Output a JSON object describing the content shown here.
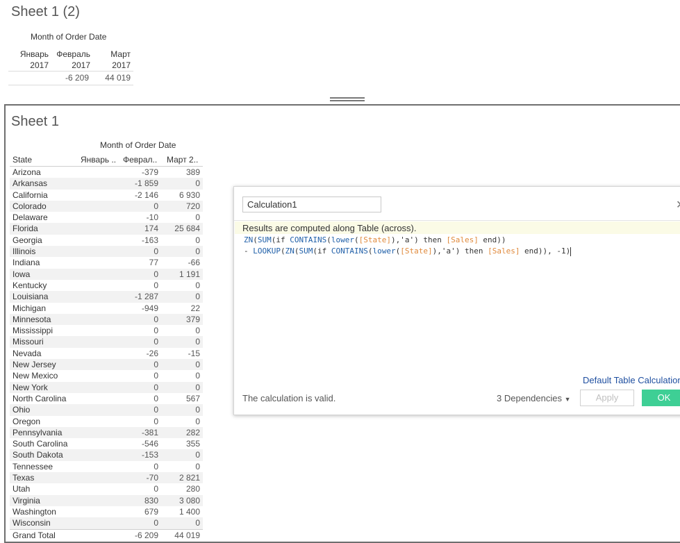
{
  "sheet2": {
    "title": "Sheet 1 (2)",
    "header_month": "Month of Order Date",
    "columns": [
      {
        "month": "Январь",
        "year": "2017"
      },
      {
        "month": "Февраль",
        "year": "2017"
      },
      {
        "month": "Март",
        "year": "2017"
      }
    ],
    "values": [
      "",
      "-6 209",
      "44 019"
    ]
  },
  "sheet1": {
    "title": "Sheet 1",
    "header_month": "Month of Order Date",
    "state_header": "State",
    "col_headers": [
      "Январь ..",
      "Феврал..",
      "Март 2.."
    ],
    "rows": [
      {
        "state": "Arizona",
        "feb": "-379",
        "mar": "389"
      },
      {
        "state": "Arkansas",
        "feb": "-1 859",
        "mar": "0"
      },
      {
        "state": "California",
        "feb": "-2 146",
        "mar": "6 930"
      },
      {
        "state": "Colorado",
        "feb": "0",
        "mar": "720"
      },
      {
        "state": "Delaware",
        "feb": "-10",
        "mar": "0"
      },
      {
        "state": "Florida",
        "feb": "174",
        "mar": "25 684"
      },
      {
        "state": "Georgia",
        "feb": "-163",
        "mar": "0"
      },
      {
        "state": "Illinois",
        "feb": "0",
        "mar": "0"
      },
      {
        "state": "Indiana",
        "feb": "77",
        "mar": "-66"
      },
      {
        "state": "Iowa",
        "feb": "0",
        "mar": "1 191"
      },
      {
        "state": "Kentucky",
        "feb": "0",
        "mar": "0"
      },
      {
        "state": "Louisiana",
        "feb": "-1 287",
        "mar": "0"
      },
      {
        "state": "Michigan",
        "feb": "-949",
        "mar": "22"
      },
      {
        "state": "Minnesota",
        "feb": "0",
        "mar": "379"
      },
      {
        "state": "Mississippi",
        "feb": "0",
        "mar": "0"
      },
      {
        "state": "Missouri",
        "feb": "0",
        "mar": "0"
      },
      {
        "state": "Nevada",
        "feb": "-26",
        "mar": "-15"
      },
      {
        "state": "New Jersey",
        "feb": "0",
        "mar": "0"
      },
      {
        "state": "New Mexico",
        "feb": "0",
        "mar": "0"
      },
      {
        "state": "New York",
        "feb": "0",
        "mar": "0"
      },
      {
        "state": "North Carolina",
        "feb": "0",
        "mar": "567"
      },
      {
        "state": "Ohio",
        "feb": "0",
        "mar": "0"
      },
      {
        "state": "Oregon",
        "feb": "0",
        "mar": "0"
      },
      {
        "state": "Pennsylvania",
        "feb": "-381",
        "mar": "282"
      },
      {
        "state": "South Carolina",
        "feb": "-546",
        "mar": "355"
      },
      {
        "state": "South Dakota",
        "feb": "-153",
        "mar": "0"
      },
      {
        "state": "Tennessee",
        "feb": "0",
        "mar": "0"
      },
      {
        "state": "Texas",
        "feb": "-70",
        "mar": "2 821"
      },
      {
        "state": "Utah",
        "feb": "0",
        "mar": "280"
      },
      {
        "state": "Virginia",
        "feb": "830",
        "mar": "3 080"
      },
      {
        "state": "Washington",
        "feb": "679",
        "mar": "1 400"
      },
      {
        "state": "Wisconsin",
        "feb": "0",
        "mar": "0"
      }
    ],
    "grand_total": {
      "state": "Grand Total",
      "feb": "-6 209",
      "mar": "44 019"
    }
  },
  "dialog": {
    "calc_name": "Calculation1",
    "close_icon": "close-icon",
    "results_text": "Results are computed along Table (across).",
    "code_line1": "ZN(SUM(if CONTAINS(lower([State]),'a') then [Sales] end))",
    "code_line2": "- LOOKUP(ZN(SUM(if CONTAINS(lower([State]),'a') then [Sales] end)), -1)",
    "default_link": "Default Table Calculation",
    "valid_text": "The calculation is valid.",
    "dependencies": "3 Dependencies",
    "apply_label": "Apply",
    "ok_label": "OK"
  }
}
